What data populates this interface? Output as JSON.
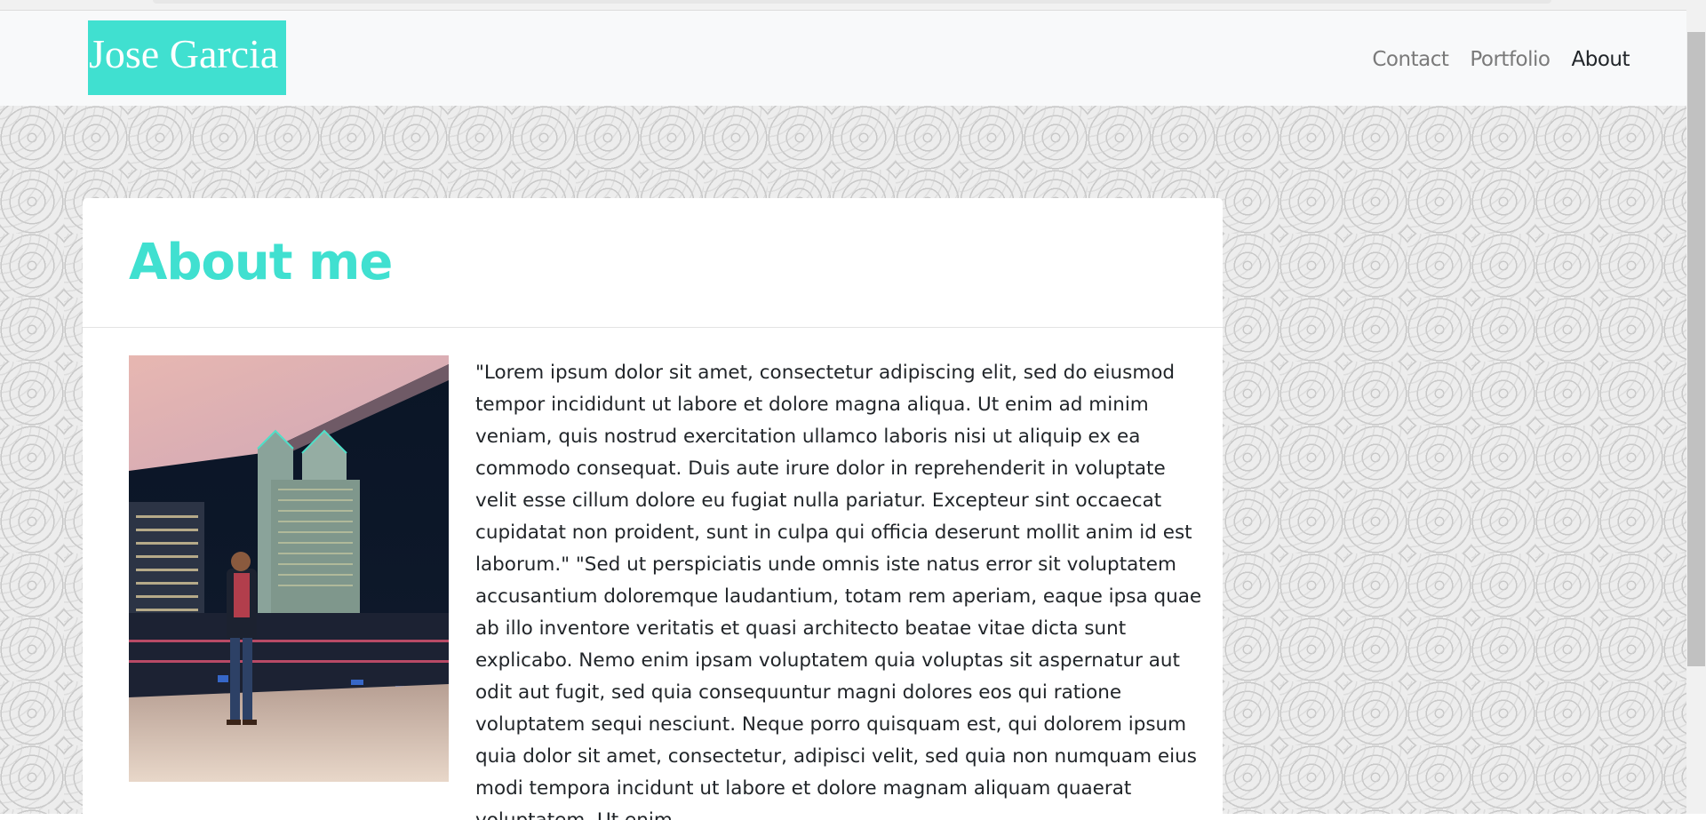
{
  "brand": {
    "name": "Jose Garcia"
  },
  "nav": {
    "items": [
      {
        "label": "Contact",
        "active": false
      },
      {
        "label": "Portfolio",
        "active": false
      },
      {
        "label": "About",
        "active": true
      }
    ]
  },
  "about": {
    "title": "About me",
    "photo_alt": "Jose Garcia standing on a balcony at night in front of a lit city skyline",
    "text": "\"Lorem ipsum dolor sit amet, consectetur adipiscing elit, sed do eiusmod tempor incididunt ut labore et dolore magna aliqua. Ut enim ad minim veniam, quis nostrud exercitation ullamco laboris nisi ut aliquip ex ea commodo consequat. Duis aute irure dolor in reprehenderit in voluptate velit esse cillum dolore eu fugiat nulla pariatur. Excepteur sint occaecat cupidatat non proident, sunt in culpa qui officia deserunt mollit anim id est laborum.\" \"Sed ut perspiciatis unde omnis iste natus error sit voluptatem accusantium doloremque laudantium, totam rem aperiam, eaque ipsa quae ab illo inventore veritatis et quasi architecto beatae vitae dicta sunt explicabo. Nemo enim ipsam voluptatem quia voluptas sit aspernatur aut odit aut fugit, sed quia consequuntur magni dolores eos qui ratione voluptatem sequi nesciunt. Neque porro quisquam est, qui dolorem ipsum quia dolor sit amet, consectetur, adipisci velit, sed quia non numquam eius modi tempora incidunt ut labore et dolore magnam aliquam quaerat voluptatem. Ut enim"
  },
  "colors": {
    "accent": "#40e0d0",
    "navbar_bg": "#f8f9fa",
    "text": "#212529",
    "nav_inactive": "#7a7a7a"
  }
}
